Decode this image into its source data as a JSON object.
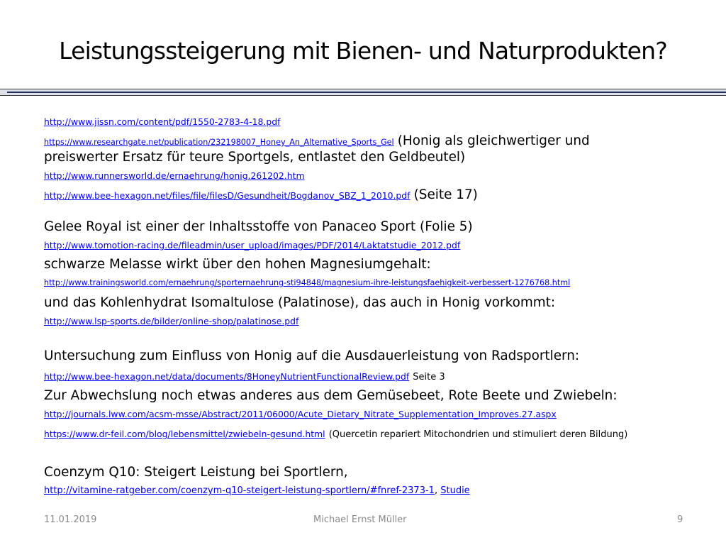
{
  "title": "Leistungssteigerung mit Bienen- und Naturprodukten?",
  "items": {
    "link1": "http://www.jissn.com/content/pdf/1550-2783-4-18.pdf",
    "link2": "https://www.researchgate.net/publication/232198007_Honey_An_Alternative_Sports_Gel",
    "link2_note": "(Honig als gleichwertiger und",
    "link2_note_cont": "preiswerter Ersatz für teure Sportgels, entlastet den Geldbeutel)",
    "link3": "http://www.runnersworld.de/ernaehrung/honig.261202.htm",
    "link4": "http://www.bee-hexagon.net/files/file/filesD/Gesundheit/Bogdanov_SBZ_1_2010.pdf",
    "link4_note": "(Seite 17)",
    "text1": "Gelee Royal ist einer der Inhaltsstoffe von Panaceo Sport (Folie 5)",
    "link5": "http://www.tomotion-racing.de/fileadmin/user_upload/images/PDF/2014/Laktatstudie_2012.pdf",
    "text2": "schwarze Melasse wirkt über den hohen Magnesiumgehalt:",
    "link6": "http://www.trainingsworld.com/ernaehrung/sporternaehrung-sti94848/magnesium-ihre-leistungsfaehigkeit-verbessert-1276768.html",
    "text3": "und das Kohlenhydrat Isomaltulose (Palatinose), das auch in Honig vorkommt:",
    "link7": "http://www.lsp-sports.de/bilder/online-shop/palatinose.pdf",
    "text4": "Untersuchung zum Einfluss von Honig auf die Ausdauerleistung von  Radsportlern:",
    "link8": "http://www.bee-hexagon.net/data/documents/8HoneyNutrientFunctionalReview.pdf",
    "link8_note": "Seite 3",
    "text5": "Zur Abwechslung noch etwas anderes aus dem Gemüsebeet, Rote Beete und Zwiebeln:",
    "link9": "http://journals.lww.com/acsm-msse/Abstract/2011/06000/Acute_Dietary_Nitrate_Supplementation_Improves.27.aspx",
    "link10": "https://www.dr-feil.com/blog/lebensmittel/zwiebeln-gesund.html",
    "link10_note": "(Quercetin repariert Mitochondrien und stimuliert deren Bildung)",
    "text6": "Coenzym Q10: Steigert Leistung bei Sportlern,",
    "link11": "http://vitamine-ratgeber.com/coenzym-q10-steigert-leistung-sportlern/#fnref-2373-1",
    "link11_sep": ",",
    "link12": "Studie"
  },
  "footer": {
    "date": "11.01.2019",
    "author": "Michael Ernst Müller",
    "page": "9"
  }
}
